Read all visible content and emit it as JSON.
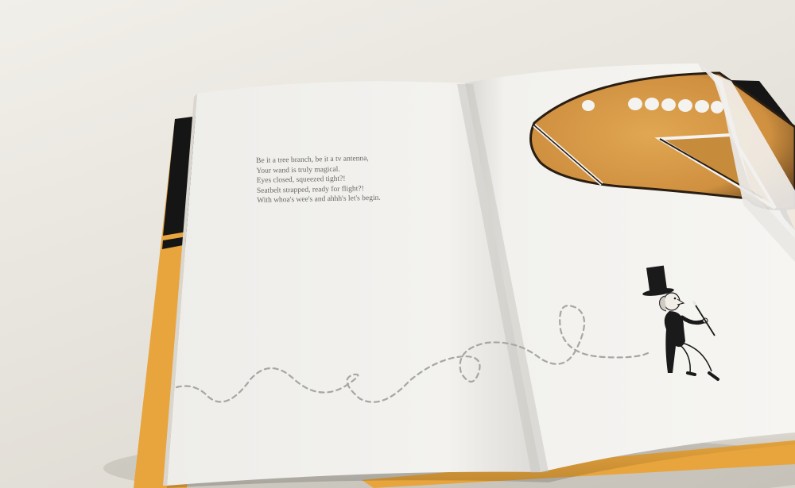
{
  "book": {
    "left_page": {
      "poem_lines": [
        "Be it a tree branch, be it a tv antenna,",
        "Your wand is truly magical.",
        "Eyes closed, squeezed tight?!",
        "Seatbelt strapped, ready for flight?!",
        "With whoa's wee's and ahhh's let's begin."
      ]
    },
    "right_page": {
      "illustration": [
        "airplane-nose",
        "magician-with-wand",
        "dashed-flight-path"
      ]
    }
  },
  "colors": {
    "cover_orange": "#e8a53d",
    "cover_black": "#151515",
    "plane_orange": "#d79a45",
    "plane_outline": "#2a1d12",
    "page_white": "#f4f3f0",
    "text_gray": "#6b6864",
    "dash_gray": "#a9a6a1"
  }
}
